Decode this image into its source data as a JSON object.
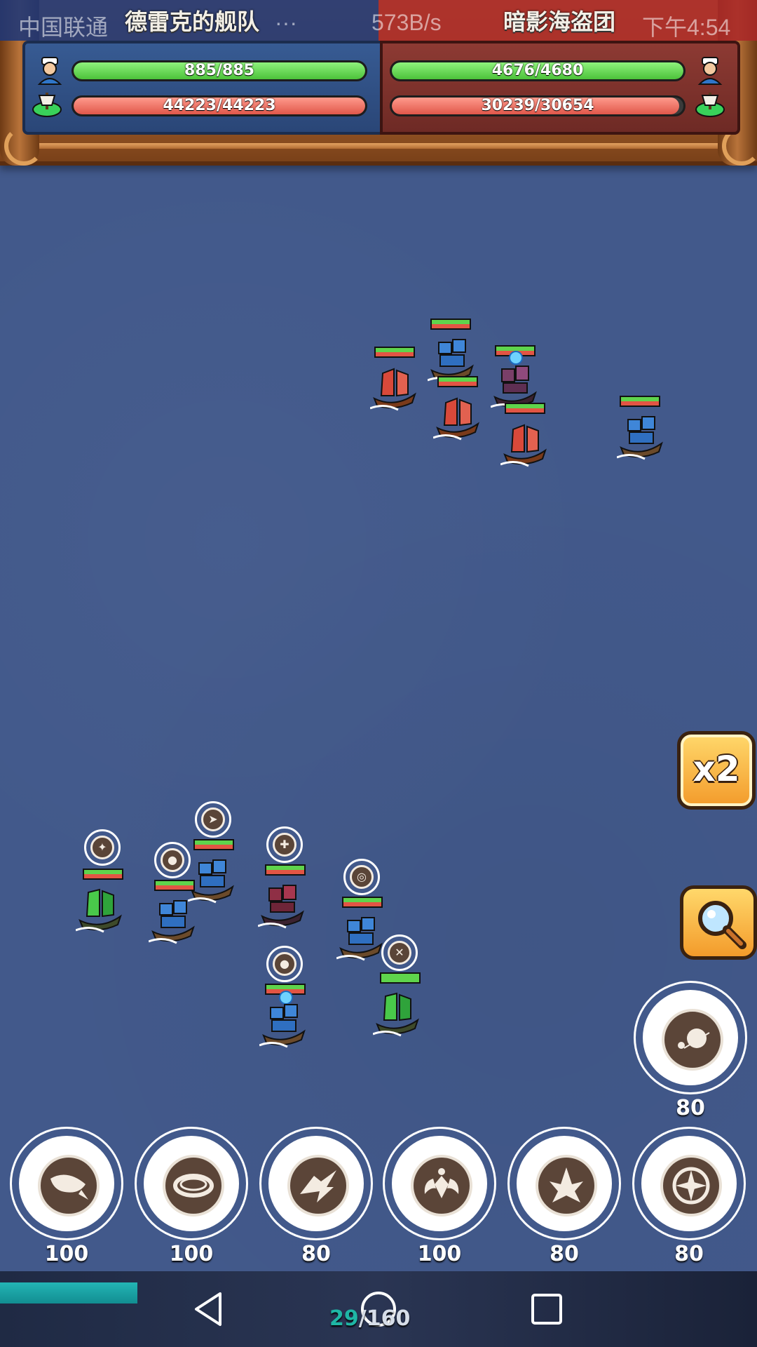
{
  "status_bar": {
    "carrier": "中国联通",
    "net_speed": "573B/s",
    "time": "下午4:54",
    "dots": "···"
  },
  "teams": {
    "left": {
      "name": "德雷克的舰队",
      "crew_hp": "885/885",
      "crew_hp_fraction": 1.0,
      "ship_hp": "44223/44223",
      "ship_hp_fraction": 1.0,
      "color": "#2e4f86"
    },
    "right": {
      "name": "暗影海盗团",
      "crew_hp": "4676/4680",
      "crew_hp_fraction": 0.999,
      "ship_hp": "30239/30654",
      "ship_hp_fraction": 0.986,
      "color": "#8a3630"
    }
  },
  "buttons": {
    "speed": "x2",
    "zoom_icon": "magnifier-icon"
  },
  "skills": [
    {
      "icon": "rocket-icon",
      "cost": "100"
    },
    {
      "icon": "ring-icon",
      "cost": "100"
    },
    {
      "icon": "shark-icon",
      "cost": "80"
    },
    {
      "icon": "wing-emblem-icon",
      "cost": "100"
    },
    {
      "icon": "spike-icon",
      "cost": "80"
    },
    {
      "icon": "compass-icon",
      "cost": "80"
    }
  ],
  "extra_skill": {
    "icon": "cannonball-icon",
    "cost": "80"
  },
  "progress": {
    "current": "29",
    "total": "/160",
    "fraction": 0.18
  },
  "colors": {
    "sea": "#42598b",
    "hp_green": "#5fd44c",
    "hp_red": "#e0574a",
    "accent_teal": "#1fb6a5"
  }
}
